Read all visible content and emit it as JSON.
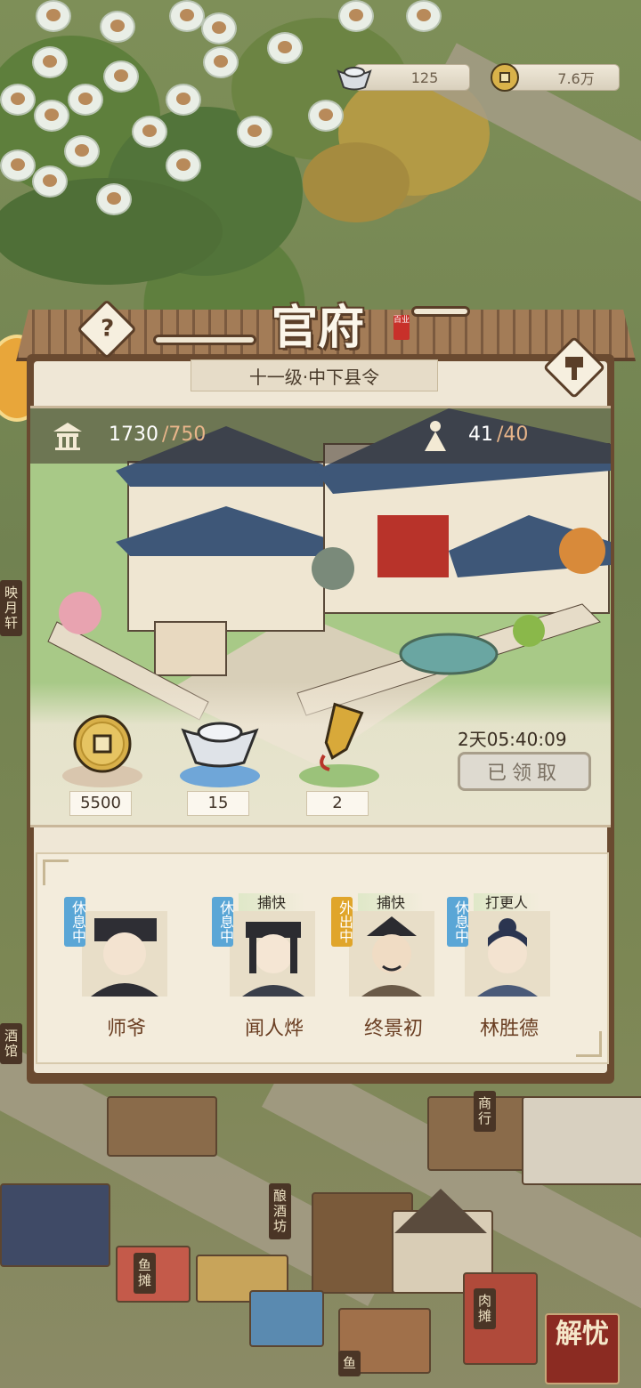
{
  "resources": {
    "silver": "125",
    "coins": "7.6万"
  },
  "dialog": {
    "title": "官府",
    "seal": "百业",
    "rank": "十一级·中下县令",
    "stats": {
      "prosperity_current": "1730",
      "prosperity_cap": "/750",
      "population_current": "41",
      "population_cap": "/40"
    },
    "rewards": [
      {
        "icon": "copper-coin-icon",
        "count": "5500"
      },
      {
        "icon": "silver-ingot-icon",
        "count": "15"
      },
      {
        "icon": "gold-token-icon",
        "count": "2"
      }
    ],
    "timer": "2天05:40:09",
    "claim_button": "已领取",
    "staff": [
      {
        "name": "师爷",
        "status": "休息中",
        "role": ""
      },
      {
        "name": "闻人烨",
        "status": "休息中",
        "role": "捕快"
      },
      {
        "name": "终景初",
        "status": "外出中",
        "role": "捕快"
      },
      {
        "name": "林胜德",
        "status": "休息中",
        "role": "打更人"
      }
    ]
  },
  "map_signs": {
    "left_top": "映月轩",
    "left_bottom": "酒馆",
    "merchant": "商行",
    "brewery": "酿酒坊",
    "fish_stall": "鱼摊",
    "meat_stall": "肉摊",
    "fish_stall_2": "鱼"
  },
  "corner_badge": "解忧",
  "colors": {
    "frame_brown": "#6a4a30",
    "panel_cream": "#efe7d6",
    "status_rest": "#5aa6d6",
    "status_out": "#e0a52a",
    "name_brown": "#6a3e22",
    "cap_orange": "#e8b58a"
  }
}
